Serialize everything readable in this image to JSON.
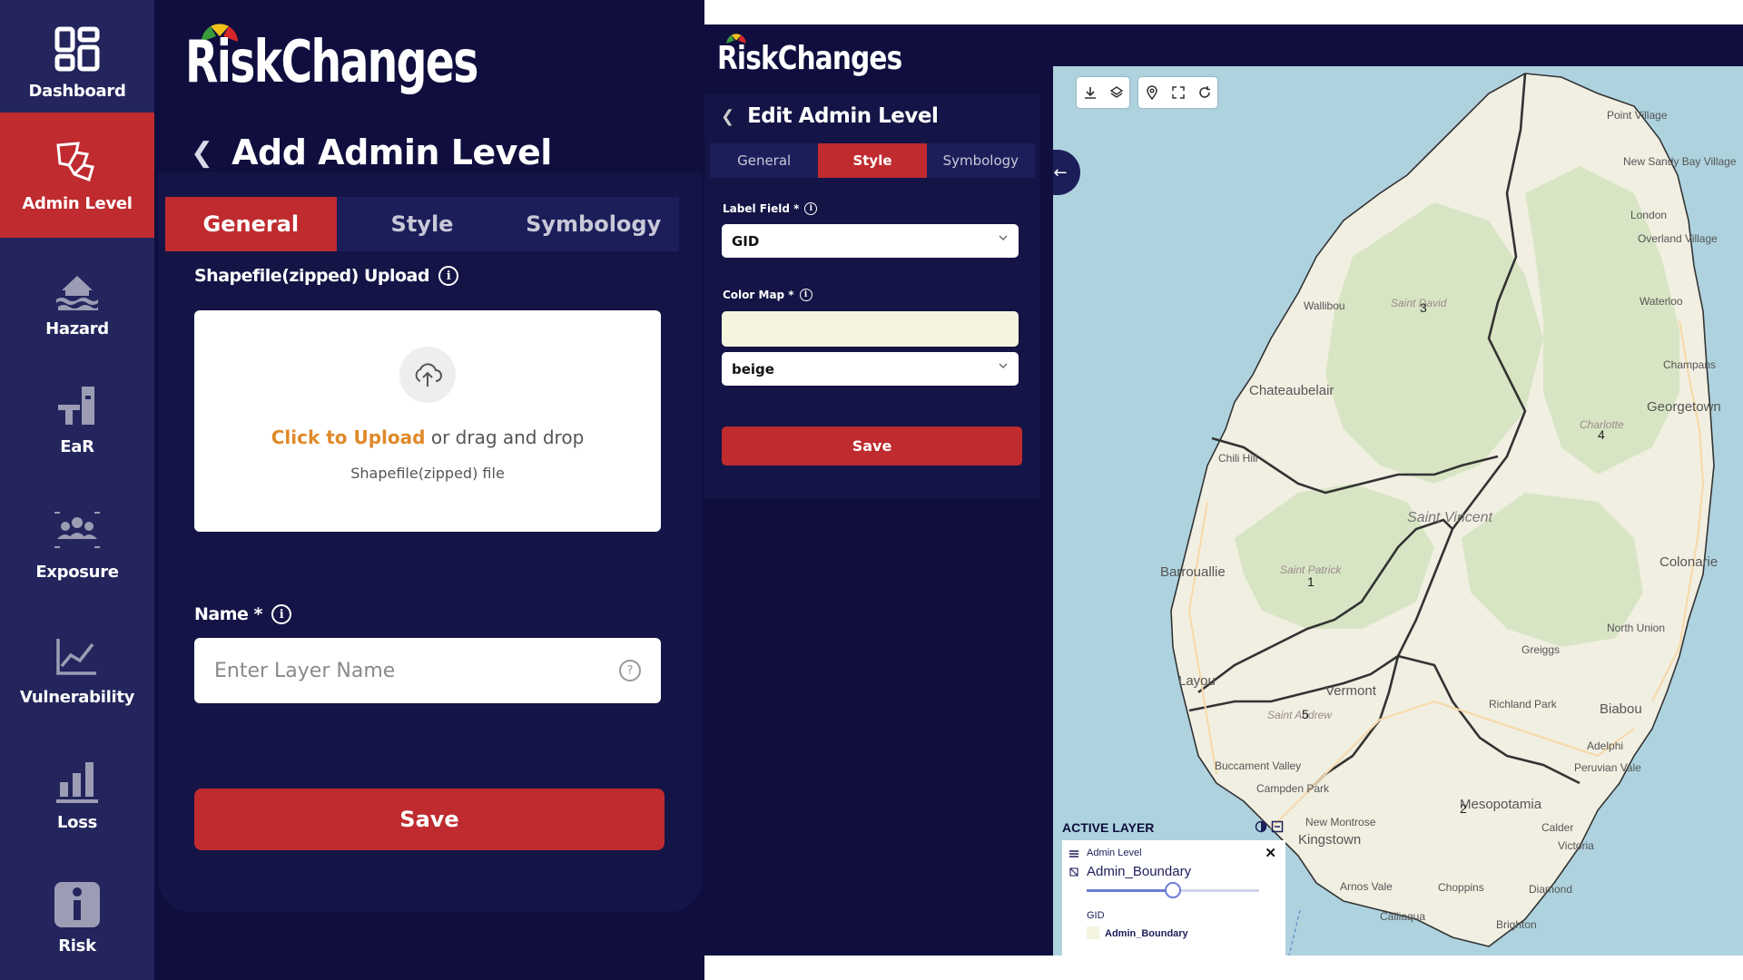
{
  "sidebar": {
    "items": [
      {
        "label": "Dashboard",
        "icon": "dashboard-icon"
      },
      {
        "label": "Admin Level",
        "icon": "admin-level-icon",
        "active": true
      },
      {
        "label": "Hazard",
        "icon": "hazard-icon"
      },
      {
        "label": "EaR",
        "icon": "ear-icon"
      },
      {
        "label": "Exposure",
        "icon": "exposure-icon"
      },
      {
        "label": "Vulnerability",
        "icon": "vulnerability-icon"
      },
      {
        "label": "Loss",
        "icon": "loss-icon"
      },
      {
        "label": "Risk",
        "icon": "risk-icon"
      }
    ]
  },
  "brand": {
    "name": "RiskChanges"
  },
  "add_panel": {
    "title": "Add Admin Level",
    "tabs": [
      "General",
      "Style",
      "Symbology"
    ],
    "active_tab": "General",
    "upload_label": "Shapefile(zipped) Upload",
    "upload_cta": "Click to Upload",
    "upload_rest": "or drag and drop",
    "upload_hint": "Shapefile(zipped) file",
    "name_label": "Name *",
    "name_placeholder": "Enter Layer Name",
    "save": "Save"
  },
  "edit_panel": {
    "title": "Edit Admin Level",
    "tabs": [
      "General",
      "Style",
      "Symbology"
    ],
    "active_tab": "Style",
    "label_field_label": "Label Field *",
    "label_field_value": "GID",
    "color_map_label": "Color Map *",
    "color_map_value": "beige",
    "color_swatch": "#f5f4de",
    "save": "Save"
  },
  "map": {
    "places": [
      "Point Village",
      "New Sandy Bay Village",
      "London",
      "Overland Village",
      "Waterloo",
      "Wallibou",
      "Chateaubelair",
      "Champans",
      "Georgetown",
      "Chili Hill",
      "Saint Vincent",
      "Colonarie",
      "Barrouallie",
      "North Union",
      "Layou",
      "Greiggs",
      "Vermont",
      "Richland Park",
      "Biabou",
      "Adelphi",
      "Peruvian Vale",
      "Buccament Valley",
      "Campden Park",
      "New Montrose",
      "Mesopotamia",
      "Calder",
      "Victoria",
      "Kingstown",
      "Arnos Vale",
      "Choppins",
      "Diamond",
      "Calliaqua",
      "Brighton"
    ],
    "italic_places": [
      "Saint David",
      "Charlotte",
      "Saint Patrick",
      "Saint Andrew"
    ],
    "region_numbers": [
      "1",
      "2",
      "3",
      "4",
      "5"
    ]
  },
  "legend": {
    "section_title": "ACTIVE LAYER",
    "group": "Admin Level",
    "layer_name": "Admin_Boundary",
    "opacity": 0.5,
    "field": "GID",
    "entry": "Admin_Boundary"
  },
  "colors": {
    "accent": "#bf2b2e",
    "navy": "#0f0e3e",
    "sidebar": "#23255c",
    "sea": "#aed3df",
    "land": "#f1efe2",
    "green": "#d8e5c4"
  }
}
